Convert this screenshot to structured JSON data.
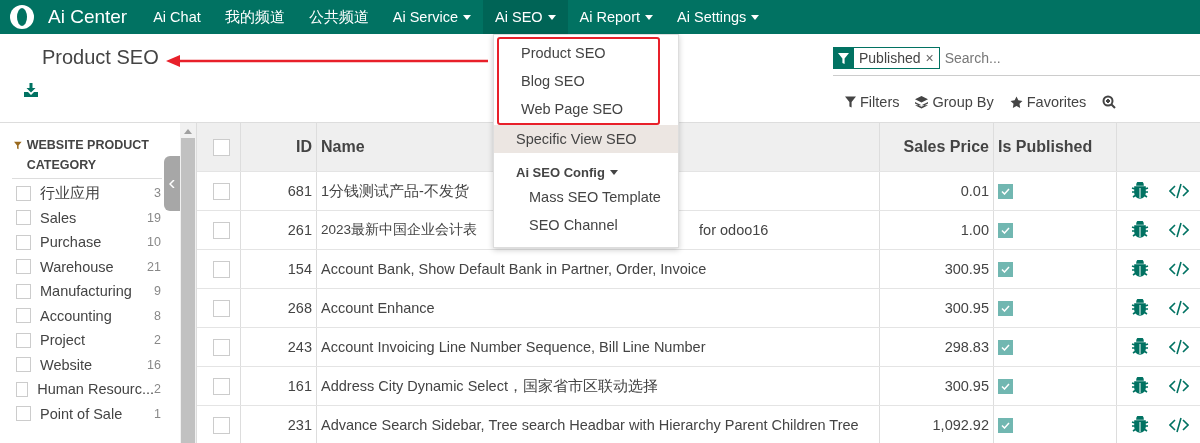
{
  "navbar": {
    "brand": "Ai Center",
    "items": [
      {
        "label": "Ai Chat",
        "dropdown": false,
        "selected": false
      },
      {
        "label": "我的频道",
        "dropdown": false,
        "selected": false
      },
      {
        "label": "公共频道",
        "dropdown": false,
        "selected": false
      },
      {
        "label": "Ai Service",
        "dropdown": true,
        "selected": false
      },
      {
        "label": "Ai SEO",
        "dropdown": true,
        "selected": true
      },
      {
        "label": "Ai Report",
        "dropdown": true,
        "selected": false
      },
      {
        "label": "Ai Settings",
        "dropdown": true,
        "selected": false
      }
    ]
  },
  "dropdown_menu": {
    "items": [
      {
        "kind": "item",
        "label": "Product SEO",
        "highlighted": true,
        "hovered": false
      },
      {
        "kind": "item",
        "label": "Blog SEO",
        "highlighted": true,
        "hovered": false
      },
      {
        "kind": "item",
        "label": "Web Page SEO",
        "highlighted": true,
        "hovered": false
      },
      {
        "kind": "item",
        "label": "Specific View SEO",
        "highlighted": false,
        "hovered": true
      },
      {
        "kind": "header",
        "label": "Ai SEO Config",
        "highlighted": false,
        "hovered": false
      },
      {
        "kind": "subitem",
        "label": "Mass SEO Template",
        "highlighted": false,
        "hovered": false
      },
      {
        "kind": "subitem",
        "label": "SEO Channel",
        "highlighted": false,
        "hovered": false
      }
    ]
  },
  "page_title": "Product SEO",
  "search": {
    "facet": "Published",
    "remove": "×",
    "placeholder": "Search..."
  },
  "search_options": [
    "Filters",
    "Group By",
    "Favorites"
  ],
  "sidebar": {
    "title": "WEBSITE PRODUCT CATEGORY",
    "items": [
      {
        "label": "行业应用",
        "count": "3",
        "checked": false
      },
      {
        "label": "Sales",
        "count": "19",
        "checked": false
      },
      {
        "label": "Purchase",
        "count": "10",
        "checked": false
      },
      {
        "label": "Warehouse",
        "count": "21",
        "checked": false
      },
      {
        "label": "Manufacturing",
        "count": "9",
        "checked": false
      },
      {
        "label": "Accounting",
        "count": "8",
        "checked": false
      },
      {
        "label": "Project",
        "count": "2",
        "checked": false
      },
      {
        "label": "Website",
        "count": "16",
        "checked": false
      },
      {
        "label": "Human Resourc...",
        "count": "2",
        "checked": false
      },
      {
        "label": "Point of Sale",
        "count": "1",
        "checked": false
      }
    ]
  },
  "table": {
    "all_selected": false,
    "columns": [
      "ID",
      "Name",
      "Sales Price",
      "Is Published"
    ],
    "rows": [
      {
        "id": "681",
        "name": "1分钱测试产品-不发货",
        "price": "0.01",
        "published": true,
        "selected": false
      },
      {
        "id": "261",
        "name": "2023最新中国企业会计表",
        "name_end": "for odoo16",
        "price": "1.00",
        "published": true,
        "selected": false
      },
      {
        "id": "154",
        "name": "Account Bank, Show Default Bank in Partner, Order, Invoice",
        "price": "300.95",
        "published": true,
        "selected": false
      },
      {
        "id": "268",
        "name": "Account Enhance",
        "price": "300.95",
        "published": true,
        "selected": false
      },
      {
        "id": "243",
        "name": "Account Invoicing Line Number Sequence, Bill Line Number",
        "price": "298.83",
        "published": true,
        "selected": false
      },
      {
        "id": "161",
        "name": "Address City Dynamic Select，国家省市区联动选择",
        "price": "300.95",
        "published": true,
        "selected": false
      },
      {
        "id": "231",
        "name": "Advance Search Sidebar, Tree search Headbar with Hierarchy Parent Children Tree",
        "price": "1,092.92",
        "published": true,
        "selected": false
      }
    ]
  }
}
